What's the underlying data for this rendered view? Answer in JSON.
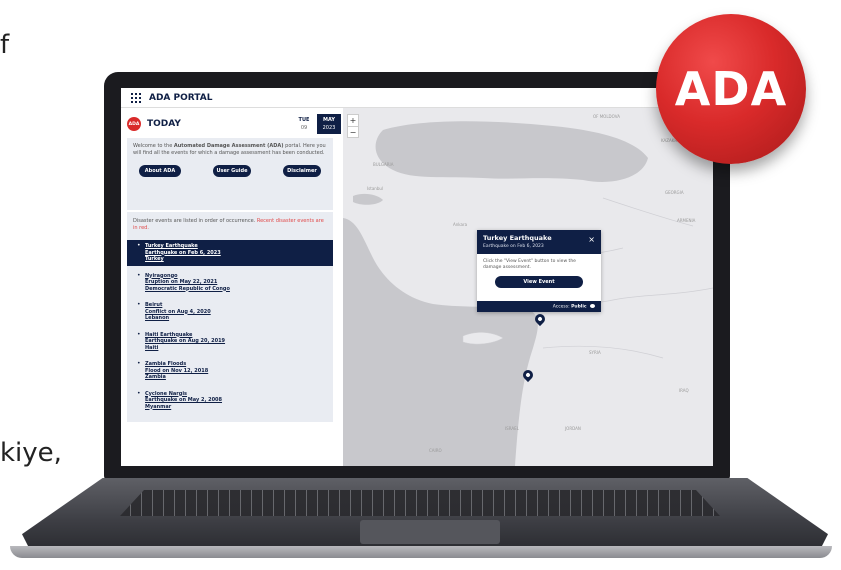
{
  "background_text": {
    "left": "f",
    "bottom": "kiye,"
  },
  "badge": {
    "label": "ADA",
    "color": "#d92a2a"
  },
  "app": {
    "title": "ADA PORTAL",
    "logo_label": "ADA",
    "today_label": "TODAY",
    "date": {
      "weekday": "TUE",
      "day": "09",
      "month": "MAY",
      "year": "2023"
    }
  },
  "intro": {
    "text_before": "Welcome to the ",
    "text_bold": "Automated Damage Assessment (ADA)",
    "text_after": " portal. Here you will find all the events for which a damage assessment has been conducted.",
    "buttons": {
      "about": "About ADA",
      "guide": "User Guide",
      "disclaimer": "Disclaimer"
    }
  },
  "list": {
    "intro": "Disaster events are listed in order of occurrence. ",
    "intro_red": "Recent disaster events are in red.",
    "events": [
      {
        "name": "Turkey Earthquake",
        "detail": "Earthquake on Feb 6, 2023",
        "location": "Turkey",
        "active": true
      },
      {
        "name": "Nyiragongo",
        "detail": "Eruption on May 22, 2021",
        "location": "Democratic Republic of Congo"
      },
      {
        "name": "Beirut",
        "detail": "Conflict on Aug 4, 2020",
        "location": "Lebanon"
      },
      {
        "name": "Haiti Earthquake",
        "detail": "Earthquake on Aug 20, 2019",
        "location": "Haiti"
      },
      {
        "name": "Zambia Floods",
        "detail": "Flood on Nov 12, 2018",
        "location": "Zambia"
      },
      {
        "name": "Cyclone Nargis",
        "detail": "Earthquake on May 2, 2008",
        "location": "Myanmar"
      }
    ]
  },
  "map": {
    "zoom_in": "+",
    "zoom_out": "−",
    "labels": [
      "OF MOLDOVA",
      "KAZAKHSTAN",
      "GEORGIA",
      "BULGARIA",
      "SYRIA",
      "JORDAN",
      "ISRAEL",
      "CAIRO",
      "IRAQ",
      "ARMENIA",
      "Ankara",
      "Istanbul"
    ]
  },
  "popup": {
    "title": "Turkey Earthquake",
    "subtitle": "Earthquake on Feb 6, 2023",
    "close": "×",
    "body": "Click the \"View Event\" button to view the damage assessment.",
    "button": "View Event",
    "access_label": "Access:",
    "access_value": "Public"
  },
  "colors": {
    "navy": "#0f1f45",
    "red_accent": "#e04848",
    "panel_bg": "#e9ecf2",
    "sea": "#c8c8cc",
    "land": "#e9e9ec"
  }
}
